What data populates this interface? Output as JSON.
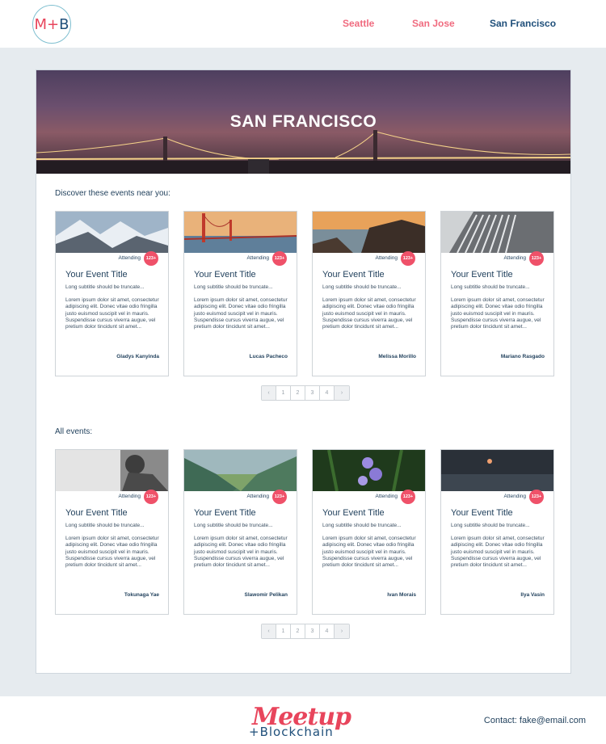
{
  "header": {
    "logo": {
      "m": "M",
      "plus": "+",
      "b": "B"
    },
    "nav": [
      "Seattle",
      "San Jose",
      "San Francisco"
    ],
    "active_nav": "San Francisco"
  },
  "hero": {
    "title": "SAN FRANCISCO"
  },
  "nearby": {
    "title": "Discover these events near you:",
    "cards": [
      {
        "title": "Your Event Title",
        "subtitle": "Long subtitle should be truncate...",
        "body": "Lorem ipsum dolor sit amet, consectetur adipiscing elit. Donec vitae odio fringilla justo euismod suscipit vel in mauris. Suspendisse cursus viverra augue, vel pretium dolor tincidunt sit amet...",
        "attending": "Attending",
        "badge": "123+",
        "author": "Gladys Kanyinda"
      },
      {
        "title": "Your Event Title",
        "subtitle": "Long subtitle should be truncate...",
        "body": "Lorem ipsum dolor sit amet, consectetur adipiscing elit. Donec vitae odio fringilla justo euismod suscipit vel in mauris. Suspendisse cursus viverra augue, vel pretium dolor tincidunt sit amet...",
        "attending": "Attending",
        "badge": "123+",
        "author": "Lucas Pacheco"
      },
      {
        "title": "Your Event Title",
        "subtitle": "Long subtitle should be truncate...",
        "body": "Lorem ipsum dolor sit amet, consectetur adipiscing elit. Donec vitae odio fringilla justo euismod suscipit vel in mauris. Suspendisse cursus viverra augue, vel pretium dolor tincidunt sit amet...",
        "attending": "Attending",
        "badge": "123+",
        "author": "Melissa Morillo"
      },
      {
        "title": "Your Event Title",
        "subtitle": "Long subtitle should be truncate...",
        "body": "Lorem ipsum dolor sit amet, consectetur adipiscing elit. Donec vitae odio fringilla justo euismod suscipit vel in mauris. Suspendisse cursus viverra augue, vel pretium dolor tincidunt sit amet...",
        "attending": "Attending",
        "badge": "123+",
        "author": "Mariano Rasgado"
      }
    ],
    "pager": {
      "prev": "‹",
      "pages": [
        "1",
        "2",
        "3",
        "4"
      ],
      "next": "›"
    }
  },
  "all": {
    "title": "All events:",
    "cards": [
      {
        "title": "Your Event Title",
        "subtitle": "Long subtitle should be truncate...",
        "body": "Lorem ipsum dolor sit amet, consectetur adipiscing elit. Donec vitae odio fringilla justo euismod suscipit vel in mauris. Suspendisse cursus viverra augue, vel pretium dolor tincidunt sit amet...",
        "attending": "Attending",
        "badge": "123+",
        "author": "Tokunaga Yae"
      },
      {
        "title": "Your Event Title",
        "subtitle": "Long subtitle should be truncate...",
        "body": "Lorem ipsum dolor sit amet, consectetur adipiscing elit. Donec vitae odio fringilla justo euismod suscipit vel in mauris. Suspendisse cursus viverra augue, vel pretium dolor tincidunt sit amet...",
        "attending": "Attending",
        "badge": "123+",
        "author": "Slawomir Pelikan"
      },
      {
        "title": "Your Event Title",
        "subtitle": "Long subtitle should be truncate...",
        "body": "Lorem ipsum dolor sit amet, consectetur adipiscing elit. Donec vitae odio fringilla justo euismod suscipit vel in mauris. Suspendisse cursus viverra augue, vel pretium dolor tincidunt sit amet...",
        "attending": "Attending",
        "badge": "123+",
        "author": "Ivan Morais"
      },
      {
        "title": "Your Event Title",
        "subtitle": "Long subtitle should be truncate...",
        "body": "Lorem ipsum dolor sit amet, consectetur adipiscing elit. Donec vitae odio fringilla justo euismod suscipit vel in mauris. Suspendisse cursus viverra augue, vel pretium dolor tincidunt sit amet...",
        "attending": "Attending",
        "badge": "123+",
        "author": "Ilya Vasin"
      }
    ],
    "pager": {
      "prev": "‹",
      "pages": [
        "1",
        "2",
        "3",
        "4"
      ],
      "next": "›"
    }
  },
  "footer": {
    "logo_top": "Meetup",
    "logo_bottom": "+Blockchain",
    "contact": "Contact: fake@email.com"
  },
  "colors": {
    "accent": "#ef5169",
    "navy": "#1f4f7a",
    "background": "#e6ebef"
  }
}
